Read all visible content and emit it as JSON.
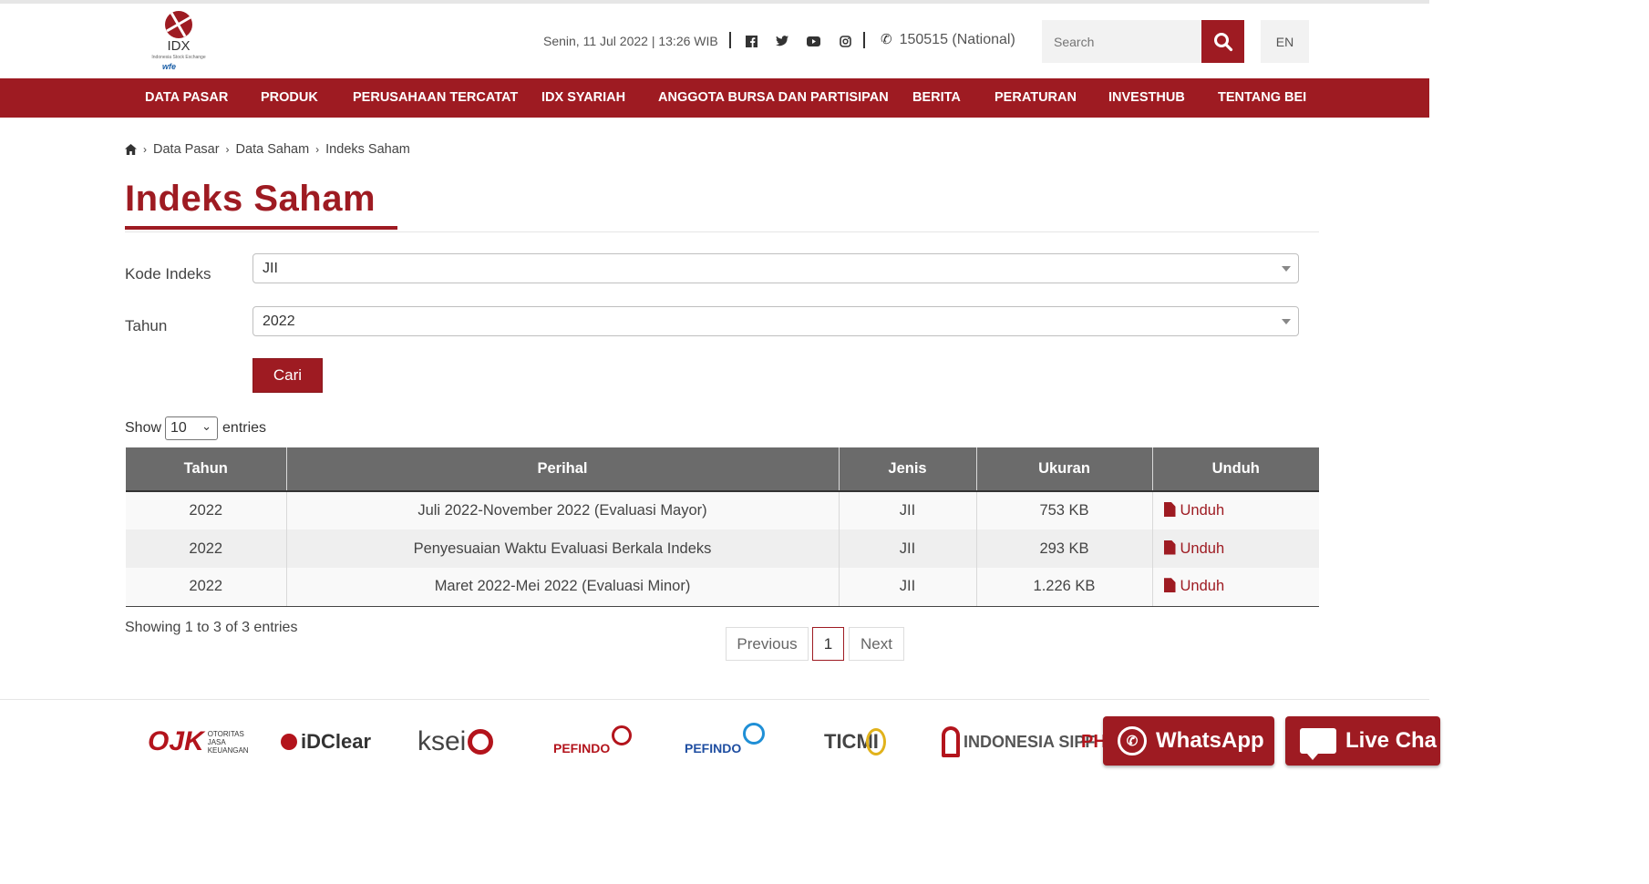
{
  "header": {
    "logo_text": "IDX",
    "logo_sub": "Indonesia Stock Exchange",
    "logo_partner": "wfe",
    "datetime": "Senin, 11 Jul 2022 | 13:26 WIB",
    "social_icons": [
      "facebook-icon",
      "twitter-icon",
      "youtube-icon",
      "instagram-icon"
    ],
    "phone": "150515 (National)",
    "search_placeholder": "Search",
    "lang": "EN"
  },
  "nav": [
    "DATA PASAR",
    "PRODUK",
    "PERUSAHAAN TERCATAT",
    "IDX SYARIAH",
    "ANGGOTA BURSA DAN PARTISIPAN",
    "BERITA",
    "PERATURAN",
    "INVESTHUB",
    "TENTANG BEI"
  ],
  "breadcrumb": [
    "Data Pasar",
    "Data Saham",
    "Indeks Saham"
  ],
  "page_title": "Indeks Saham",
  "form": {
    "kode_label": "Kode Indeks",
    "kode_value": "JII",
    "tahun_label": "Tahun",
    "tahun_value": "2022",
    "submit_label": "Cari"
  },
  "length_menu": {
    "show": "Show",
    "value": "10",
    "entries": "entries"
  },
  "table": {
    "headers": [
      "Tahun",
      "Perihal",
      "Jenis",
      "Ukuran",
      "Unduh"
    ],
    "rows": [
      {
        "tahun": "2022",
        "perihal": "Juli 2022-November 2022 (Evaluasi Mayor)",
        "jenis": "JII",
        "ukuran": "753 KB",
        "unduh": "Unduh"
      },
      {
        "tahun": "2022",
        "perihal": "Penyesuaian Waktu Evaluasi Berkala Indeks",
        "jenis": "JII",
        "ukuran": "293 KB",
        "unduh": "Unduh"
      },
      {
        "tahun": "2022",
        "perihal": "Maret 2022-Mei 2022 (Evaluasi Minor)",
        "jenis": "JII",
        "ukuran": "1.226 KB",
        "unduh": "Unduh"
      }
    ]
  },
  "table_info": "Showing 1 to 3 of 3 entries",
  "pagination": {
    "previous": "Previous",
    "page": "1",
    "next": "Next"
  },
  "partners": [
    "OJK",
    "iDClear",
    "ksei",
    "PEFINDO",
    "PEFINDO",
    "TICMI",
    "INDONESIA SIPF",
    "PH"
  ],
  "widgets": {
    "whatsapp": "WhatsApp",
    "livechat": "Live Cha"
  },
  "colors": {
    "brand": "#9e1b22",
    "table_header": "#6b6b6b"
  }
}
